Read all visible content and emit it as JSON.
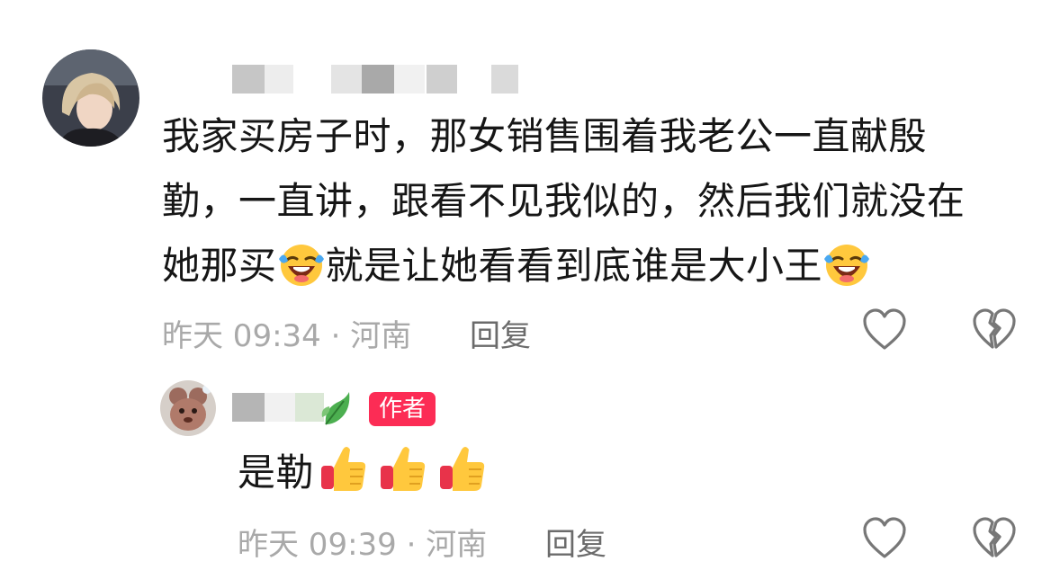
{
  "comment": {
    "text_lines": [
      "我家买房子时，那女销售围着我老公一直献殷",
      "勤，一直讲，跟看不见我似的，然后我们就没在"
    ],
    "line3_before": "她那买",
    "line3_middle": "就是让她看看到底谁是大小王",
    "emoji": "laughing-crying-emoji",
    "meta": "昨天 09:34 · 河南",
    "reply_label": "回复"
  },
  "reply": {
    "badge": "作者",
    "text": "是勒",
    "emoji": "thumbs-up-emoji",
    "thumbs_count": 3,
    "meta": "昨天 09:39 · 河南",
    "reply_label": "回复"
  },
  "icons": [
    "heart-outline-icon",
    "broken-heart-icon",
    "leaf-icon"
  ],
  "colors": {
    "badge": "#fc2c55",
    "meta": "#a9a9a9",
    "reply": "#6b6b6b",
    "text": "#161616"
  }
}
